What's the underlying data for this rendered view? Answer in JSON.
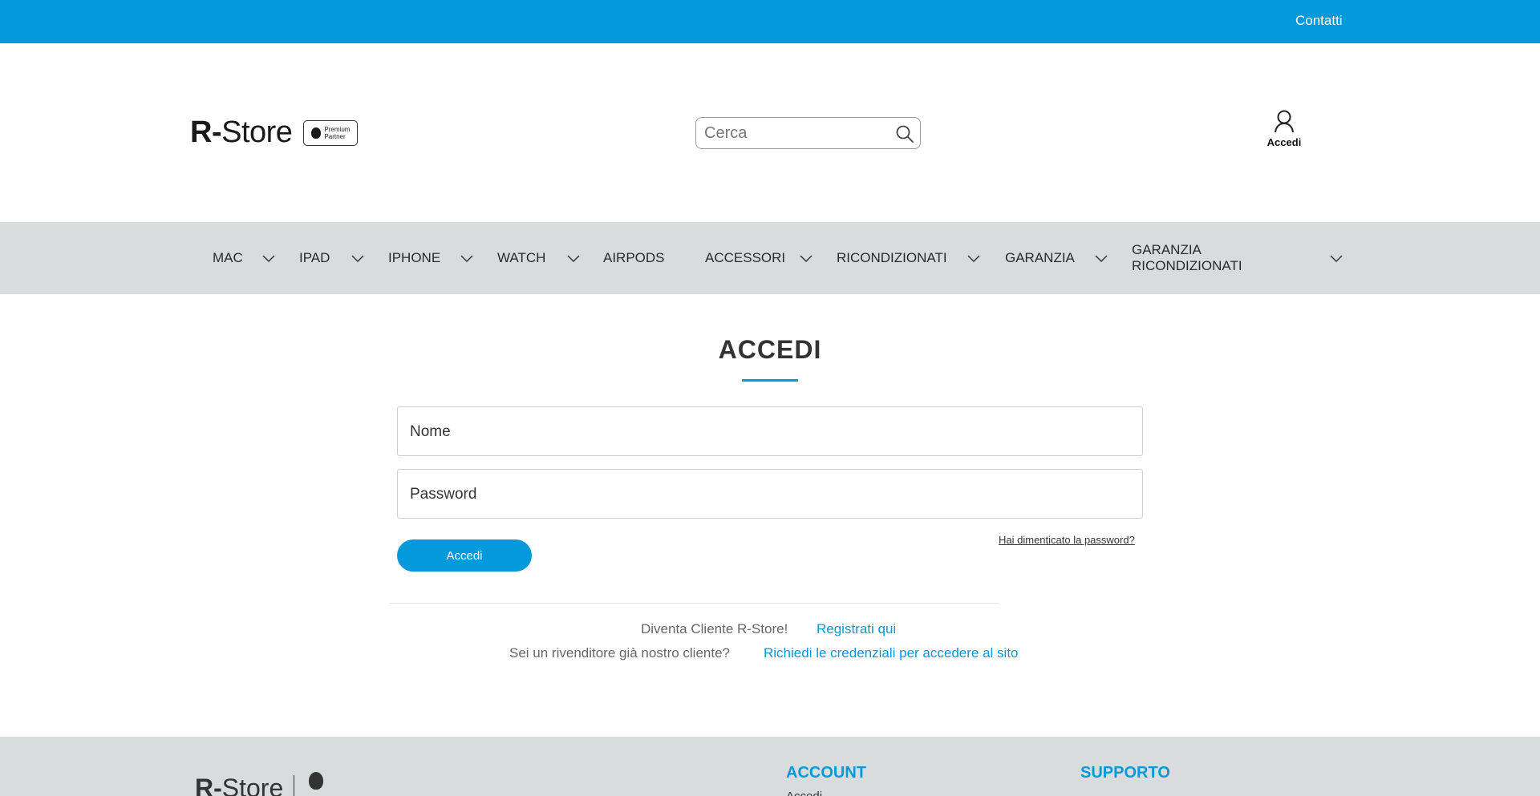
{
  "topbar": {
    "contatti": "Contatti"
  },
  "header": {
    "logo_r": "R-",
    "logo_store": "Store",
    "badge_line1": "Premium",
    "badge_line2": "Partner",
    "search_placeholder": "Cerca",
    "account_label": "Accedi"
  },
  "nav": {
    "items": [
      {
        "label": "MAC",
        "dropdown": true
      },
      {
        "label": "IPAD",
        "dropdown": true
      },
      {
        "label": "IPHONE",
        "dropdown": true
      },
      {
        "label": "WATCH",
        "dropdown": true
      },
      {
        "label": "AIRPODS",
        "dropdown": false
      },
      {
        "label": "ACCESSORI",
        "dropdown": true
      },
      {
        "label": "RICONDIZIONATI",
        "dropdown": true
      },
      {
        "label": "GARANZIA",
        "dropdown": true
      },
      {
        "label": "GARANZIA RICONDIZIONATI",
        "dropdown": true
      }
    ]
  },
  "login": {
    "title": "ACCEDI",
    "name_placeholder": "Nome",
    "password_placeholder": "Password",
    "submit_label": "Accedi",
    "forgot_label": "Hai dimenticato la password?"
  },
  "register": {
    "prompt": "Diventa Cliente R-Store!",
    "link": "Registrati qui"
  },
  "reseller": {
    "prompt": "Sei un rivenditore già nostro cliente?",
    "link": "Richiedi le credenziali per accedere al sito"
  },
  "footer": {
    "logo_r": "R-",
    "logo_store": "Store",
    "account_heading": "ACCOUNT",
    "account_first": "Accedi",
    "support_heading": "SUPPORTO"
  },
  "colors": {
    "accent": "#0399db",
    "nav_bg": "#d9dcdd",
    "text": "#333333"
  }
}
